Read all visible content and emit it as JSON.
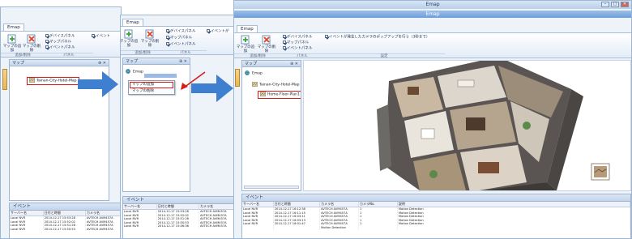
{
  "screen1": {
    "tab": "Emap",
    "ribbon": {
      "add_map": "マップの追加",
      "delete_map": "マップの削除",
      "checks": [
        "デバイスパネル",
        "マップパネル",
        "イベントパネル",
        "イベント"
      ],
      "groups": [
        "追加/削除",
        "パネル"
      ]
    },
    "map_panel": {
      "title": "マップ",
      "pin": "⊕ ✕",
      "node": "Tainan-City-Hotel-Map"
    },
    "events": {
      "title": "イベント",
      "columns": [
        "サーバー名",
        "日付と時間",
        "カメラ名"
      ],
      "rows": [
        [
          "Local NVR",
          "2014-12-17 15:53:28",
          "AVTECH AVM457A"
        ],
        [
          "Local NVR",
          "2014-12-17 15:52:02",
          "AVTECH AVM457A"
        ],
        [
          "Local NVR",
          "2014-12-17 15:51:28",
          "AVTECH AVM457A"
        ],
        [
          "Local NVR",
          "2014-12-17 15:50:53",
          "AVTECH AVM457A"
        ]
      ]
    }
  },
  "screen2": {
    "tab": "Emap",
    "ribbon": {
      "add_map": "マップの追加",
      "delete_map": "マップの削除",
      "checks": [
        "デバイスパネル",
        "マップパネル",
        "イベントパネル",
        "イベントが"
      ],
      "groups": [
        "追加/削除",
        "パネル"
      ]
    },
    "map_panel": {
      "title": "マップ",
      "pin": "⊕ ✕",
      "node": "Emap"
    },
    "context_menu": [
      "マップの追加",
      "マップの削除"
    ],
    "events": {
      "title": "イベント",
      "columns": [
        "サーバー名",
        "日付と時間",
        "カメラ名"
      ],
      "rows": [
        [
          "Local NVR",
          "2014-12-17 15:53:28",
          "AVTECH AVM457A"
        ],
        [
          "Local NVR",
          "2014-12-17 15:52:02",
          "AVTECH AVM457A"
        ],
        [
          "Local NVR",
          "2014-12-17 15:51:28",
          "AVTECH AVM457A"
        ],
        [
          "Local NVR",
          "2014-12-17 15:50:53",
          "AVTECH AVM457A"
        ],
        [
          "Local NVR",
          "2014-12-17 15:46:36",
          "AVTECH AVM457A"
        ]
      ]
    }
  },
  "screen3": {
    "window_title": "Emap",
    "sub_title": "Emap",
    "window_controls": [
      "–",
      "□",
      "✕"
    ],
    "tab": "Emap",
    "ribbon": {
      "add_map": "マップの追加",
      "delete_map": "マップの削除",
      "checks": [
        "デバイスパネル",
        "マップパネル",
        "イベントパネル"
      ],
      "popup_check": "イベントが発生したカメラのポップアップを行う（3秒まで）",
      "groups": [
        "追加/削除",
        "パネル",
        "設定"
      ]
    },
    "map_panel": {
      "title": "マップ",
      "pin": "⊕ ✕",
      "nodes": [
        "Emap",
        "Tainan-City-Hotel-Map",
        "Home-Floor-Plan1"
      ]
    },
    "events": {
      "title": "イベント",
      "columns": [
        "サーバー名",
        "日付と時間",
        "カメラ名",
        "カメラNo.",
        "説明"
      ],
      "rows": [
        [
          "Local NVR",
          "2014-12-17 16:12:38",
          "AVTECH AVM457A",
          "1",
          "Motion Detection"
        ],
        [
          "Local NVR",
          "2014-12-17 16:11:15",
          "AVTECH AVM457A",
          "1",
          "Motion Detection"
        ],
        [
          "Local NVR",
          "2014-12-17 16:03:11",
          "AVTECH AVM457A",
          "1",
          "Motion Detection"
        ],
        [
          "Local NVR",
          "2014-12-17 16:03:13",
          "AVTECH AVM457A",
          "1",
          "Motion Detection"
        ],
        [
          "Local NVR",
          "2014-12-17 16:01:47",
          "AVTECH AVM457A",
          "1",
          "Motion Detection"
        ],
        [
          "",
          "",
          "Motion Detection",
          "",
          ""
        ]
      ]
    }
  },
  "colors": {
    "arrow": "#3f7fd0",
    "highlight": "#d61b1b",
    "ribbon_accent": "#6e9dd8"
  },
  "icons": [
    "add-map-icon",
    "delete-map-icon",
    "globe-icon",
    "map-thumbnail-icon",
    "step-arrow-icon",
    "pointer-arrow-icon"
  ]
}
